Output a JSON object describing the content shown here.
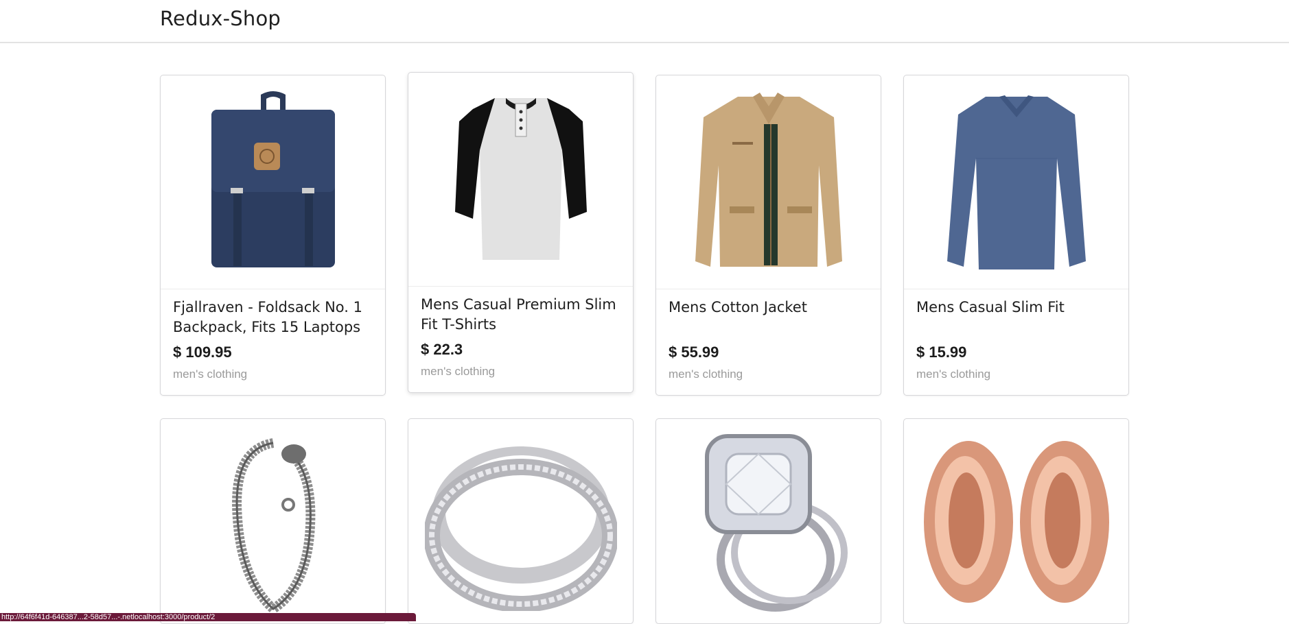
{
  "header": {
    "brand": "Redux-Shop"
  },
  "products": [
    {
      "title": "Fjallraven - Foldsack No. 1 Backpack, Fits 15 Laptops",
      "price": "$ 109.95",
      "category": "men's clothing",
      "image": "backpack-image"
    },
    {
      "title": "Mens Casual Premium Slim Fit T-Shirts",
      "price": "$ 22.3",
      "category": "men's clothing",
      "image": "tshirt-image"
    },
    {
      "title": "Mens Cotton Jacket",
      "price": "$ 55.99",
      "category": "men's clothing",
      "image": "jacket-image"
    },
    {
      "title": "Mens Casual Slim Fit",
      "price": "$ 15.99",
      "category": "men's clothing",
      "image": "longsleeve-image"
    },
    {
      "image": "bracelet-image"
    },
    {
      "image": "silver-ring-image"
    },
    {
      "image": "diamond-ring-image"
    },
    {
      "image": "rose-gold-plugs-image"
    }
  ],
  "status_bar": {
    "url": "http://64f6f41d-646387...2-58d57...-.netlocalhost:3000/product/2"
  },
  "colors": {
    "card_border": "#d6d6d9",
    "category_text": "#9a9a9a",
    "status_bar_bg": "#6b1a3a"
  }
}
